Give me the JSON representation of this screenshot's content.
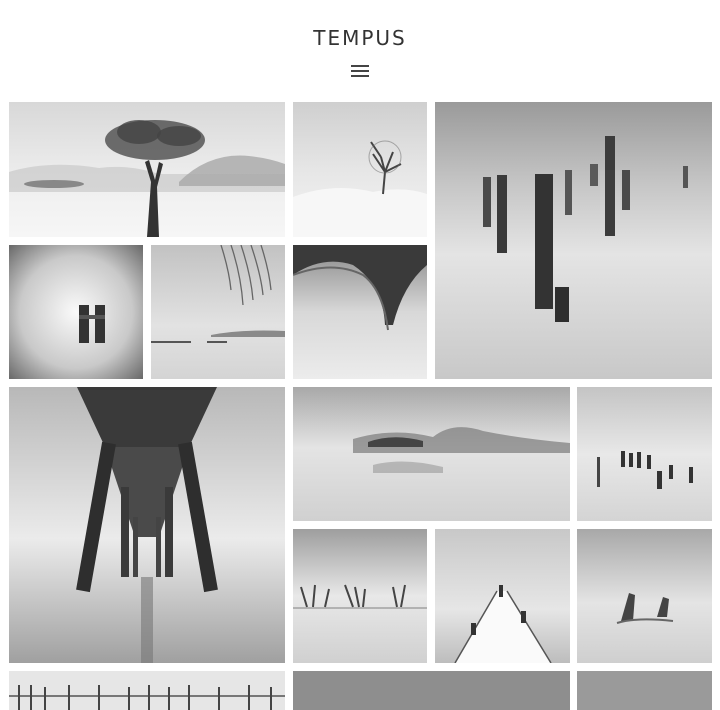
{
  "site": {
    "title": "TEMPUS"
  },
  "menu": {
    "icon": "hamburger-menu-icon"
  },
  "gallery": {
    "items": [
      {
        "id": "tree-foggy-mountains"
      },
      {
        "id": "small-tree-snow"
      },
      {
        "id": "posts-in-lake"
      },
      {
        "id": "twin-pillars-horizon"
      },
      {
        "id": "willow-branches-pier"
      },
      {
        "id": "bridge-arch-fog"
      },
      {
        "id": "under-pier-perspective"
      },
      {
        "id": "misty-island-hills"
      },
      {
        "id": "scattered-posts-water"
      },
      {
        "id": "fishing-poles-shore"
      },
      {
        "id": "snow-jetty"
      },
      {
        "id": "wrecked-boats-water"
      },
      {
        "id": "fence-posts-row"
      },
      {
        "id": "gray-water-bottom-center"
      },
      {
        "id": "gray-water-bottom-right"
      }
    ]
  }
}
